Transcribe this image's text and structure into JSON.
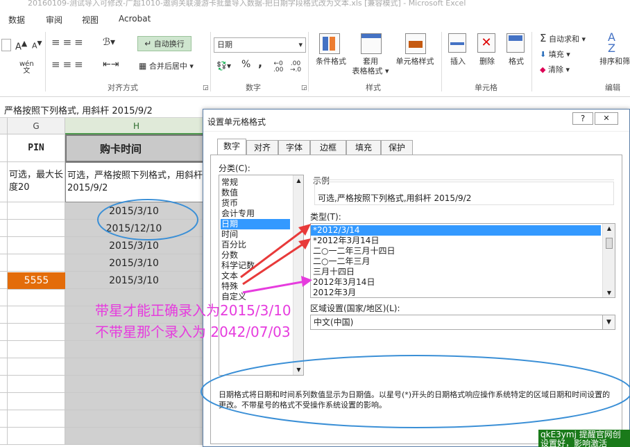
{
  "window_title": "20160109-测试导入可修改-广超1010-遨驹关联漫游卡批量导入数据-把日期字段格式改为文本.xls  [兼容模式] - Microsoft Excel",
  "ribbon_tabs": [
    "数据",
    "审阅",
    "视图",
    "Acrobat"
  ],
  "ribbon": {
    "wrap_text": "自动换行",
    "merge_center": "合并后居中",
    "align_group": "对齐方式",
    "number_format_value": "日期",
    "number_group": "数字",
    "percent": "%",
    "comma": ",",
    "cond_format": "条件格式",
    "table_format_1": "套用",
    "table_format_2": "表格格式",
    "cell_styles": "单元格样式",
    "styles_group": "样式",
    "insert": "插入",
    "delete": "删除",
    "format": "格式",
    "cells_group": "单元格",
    "autosum": "自动求和",
    "fill": "填充",
    "clear": "清除",
    "sort_filter": "排序和筛",
    "editing_group": "编辑"
  },
  "formula_text": "严格按照下列格式, 用斜杆 2015/9/2",
  "sheet": {
    "col_g": "G",
    "col_h": "H",
    "header_g": "PIN",
    "header_h": "购卡时间",
    "note_g": "可选，最大长度20",
    "note_h": "可选，严格按照下列格式，用斜杆 2015/9/2",
    "pin_value": "5555",
    "dates": [
      "2015/3/10",
      "2015/12/10",
      "2015/3/10",
      "2015/3/10",
      "2015/3/10"
    ]
  },
  "dialog": {
    "title": "设置单元格格式",
    "help": "?",
    "close": "✕",
    "tabs": [
      "数字",
      "对齐",
      "字体",
      "边框",
      "填充",
      "保护"
    ],
    "category_label": "分类(C):",
    "categories": [
      "常规",
      "数值",
      "货币",
      "会计专用",
      "日期",
      "时间",
      "百分比",
      "分数",
      "科学记数",
      "文本",
      "特殊",
      "自定义"
    ],
    "selected_category": "日期",
    "sample_label": "示例",
    "sample_value": "可选,严格按照下列格式,用斜杆 2015/9/2",
    "type_label": "类型(T):",
    "types": [
      "*2012/3/14",
      "*2012年3月14日",
      "二○一二年三月十四日",
      "二○一二年三月",
      "三月十四日",
      "2012年3月14日",
      "2012年3月"
    ],
    "selected_type": "*2012/3/14",
    "locale_label": "区域设置(国家/地区)(L):",
    "locale_value": "中文(中国)",
    "description": "日期格式将日期和时间系列数值显示为日期值。以星号(*)开头的日期格式响应操作系统特定的区域日期和时间设置的更改。不带星号的格式不受操作系统设置的影响。"
  },
  "annotations": {
    "line1": "带星才能正确录入为2015/3/10",
    "line2": "不带星那个录入为 2042/07/03"
  },
  "watermark": "qkE3ymj 提醒官网创 设置好，影响激活",
  "colors": {
    "accent": "#3399ff",
    "annotation": "#e63cde",
    "ellipse": "#3a8fd6",
    "pin_bg": "#e36c0a",
    "watermark_bg": "#1a7a1a"
  }
}
